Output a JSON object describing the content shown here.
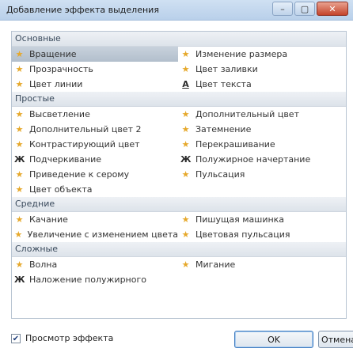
{
  "title": "Добавление эффекта выделения",
  "window_buttons": {
    "minimize": "–",
    "maximize": "▢",
    "close": "✕"
  },
  "sections": [
    {
      "name": "Основные",
      "rows": [
        [
          {
            "label": "Вращение",
            "icon": "star-icon",
            "selected": true
          },
          {
            "label": "Изменение размера",
            "icon": "star-icon"
          }
        ],
        [
          {
            "label": "Прозрачность",
            "icon": "star-icon"
          },
          {
            "label": "Цвет заливки",
            "icon": "star-icon"
          }
        ],
        [
          {
            "label": "Цвет линии",
            "icon": "star-icon"
          },
          {
            "label": "Цвет текста",
            "icon": "text-color-icon"
          }
        ]
      ]
    },
    {
      "name": "Простые",
      "rows": [
        [
          {
            "label": "Высветление",
            "icon": "star-icon"
          },
          {
            "label": "Дополнительный цвет",
            "icon": "star-icon"
          }
        ],
        [
          {
            "label": "Дополнительный цвет 2",
            "icon": "star-icon"
          },
          {
            "label": "Затемнение",
            "icon": "star-icon"
          }
        ],
        [
          {
            "label": "Контрастирующий цвет",
            "icon": "star-icon"
          },
          {
            "label": "Перекрашивание",
            "icon": "star-icon"
          }
        ],
        [
          {
            "label": "Подчеркивание",
            "icon": "bold-mark-icon"
          },
          {
            "label": "Полужирное начертание",
            "icon": "bold-mark-icon"
          }
        ],
        [
          {
            "label": "Приведение к серому",
            "icon": "star-icon"
          },
          {
            "label": "Пульсация",
            "icon": "star-icon"
          }
        ],
        [
          {
            "label": "Цвет объекта",
            "icon": "star-icon"
          }
        ]
      ]
    },
    {
      "name": "Средние",
      "rows": [
        [
          {
            "label": "Качание",
            "icon": "star-icon"
          },
          {
            "label": "Пишущая машинка",
            "icon": "star-icon"
          }
        ],
        [
          {
            "label": "Увеличение с изменением цвета",
            "icon": "star-icon"
          },
          {
            "label": "Цветовая пульсация",
            "icon": "star-icon"
          }
        ]
      ]
    },
    {
      "name": "Сложные",
      "rows": [
        [
          {
            "label": "Волна",
            "icon": "star-icon"
          },
          {
            "label": "Мигание",
            "icon": "star-icon"
          }
        ],
        [
          {
            "label": "Наложение полужирного",
            "icon": "bold-mark-icon"
          }
        ]
      ]
    }
  ],
  "footer": {
    "preview_checkbox_label": "Просмотр эффекта",
    "preview_checked": true,
    "ok_label": "OK",
    "cancel_label": "Отмена"
  },
  "colors": {
    "star": "#e6a82a",
    "selected_row": "#b9c5d1",
    "section_header": "#e4e9ef"
  }
}
